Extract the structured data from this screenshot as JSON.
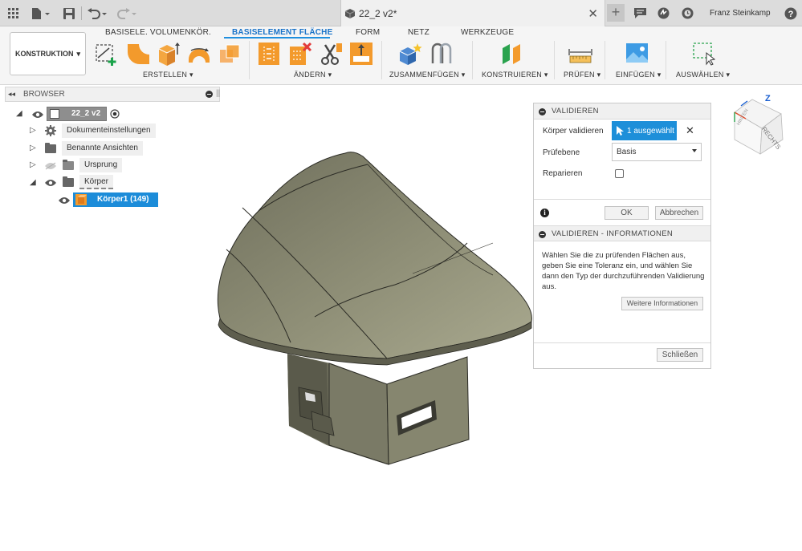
{
  "document": {
    "title": "22_2 v2*"
  },
  "user": {
    "name": "Franz Steinkamp"
  },
  "ribbon": {
    "workspace": "KONSTRUKTION",
    "tabs": [
      {
        "label": "BASISELE. VOLUMENKÖR.",
        "active": false
      },
      {
        "label": "BASISELEMENT FLÄCHE",
        "active": true
      },
      {
        "label": "FORM",
        "active": false
      },
      {
        "label": "NETZ",
        "active": false
      },
      {
        "label": "WERKZEUGE",
        "active": false
      }
    ],
    "groups": [
      {
        "label": "ERSTELLEN ▾"
      },
      {
        "label": "ÄNDERN ▾"
      },
      {
        "label": "ZUSAMMENFÜGEN ▾"
      },
      {
        "label": "KONSTRUIEREN ▾"
      },
      {
        "label": "PRÜFEN ▾"
      },
      {
        "label": "EINFÜGEN ▾"
      },
      {
        "label": "AUSWÄHLEN ▾"
      }
    ]
  },
  "browser": {
    "title": "BROWSER",
    "items": [
      {
        "label": "22_2 v2"
      },
      {
        "label": "Dokumenteinstellungen"
      },
      {
        "label": "Benannte Ansichten"
      },
      {
        "label": "Ursprung"
      },
      {
        "label": "Körper"
      },
      {
        "label": "Körper1 (149)"
      }
    ]
  },
  "validate_dialog": {
    "title": "VALIDIEREN",
    "body_label": "Körper validieren",
    "body_selection": "1 ausgewählt",
    "level_label": "Prüfebene",
    "level_value": "Basis",
    "repair_label": "Reparieren",
    "repair_checked": false,
    "ok_label": "OK",
    "cancel_label": "Abbrechen",
    "info_title": "VALIDIEREN - INFORMATIONEN",
    "info_text": "Wählen Sie die zu prüfenden Flächen aus, geben Sie eine Toleranz ein, und wählen Sie dann den Typ der durchzuführenden Validierung aus.",
    "more_info_label": "Weitere Informationen",
    "close_label": "Schließen"
  },
  "viewcube": {
    "axis_label": "Z",
    "face_label": "RECHTS",
    "back_label": "HINTEN"
  },
  "colors": {
    "accent": "#1f8fde",
    "selection": "#1d8fd9",
    "model": "#8c8c74"
  }
}
